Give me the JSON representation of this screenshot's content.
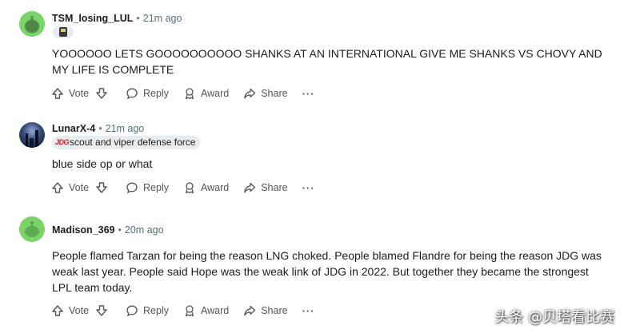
{
  "comments": [
    {
      "username": "TSM_losing_LUL",
      "time": "21m ago",
      "avatar": "snoo-icon",
      "flair_text": "",
      "body": "YOOOOOO LETS GOOOOOOOOOO SHANKS AT AN INTERNATIONAL GIVE ME SHANKS VS CHOVY AND MY LIFE IS COMPLETE"
    },
    {
      "username": "LunarX-4",
      "time": "21m ago",
      "avatar": "space-avatar",
      "flair_prefix": "JDG",
      "flair_text": "scout and viper defense force",
      "body": "blue side op or what"
    },
    {
      "username": "Madison_369",
      "time": "20m ago",
      "avatar": "snoo-icon",
      "flair_text": "",
      "body": "People flamed Tarzan for being the reason LNG choked. People blamed Flandre for being the reason JDG was weak last year. People said Hope was the weak link of JDG in 2022. But together they became the strongest LPL team today."
    }
  ],
  "actions": {
    "vote": "Vote",
    "reply": "Reply",
    "award": "Award",
    "share": "Share",
    "more": "···"
  },
  "watermark": "头条 @贝塔看比赛",
  "colors": {
    "avatar_green": "#7bd46a",
    "text_muted": "#576f76",
    "flair_bg": "#e8ecee"
  }
}
